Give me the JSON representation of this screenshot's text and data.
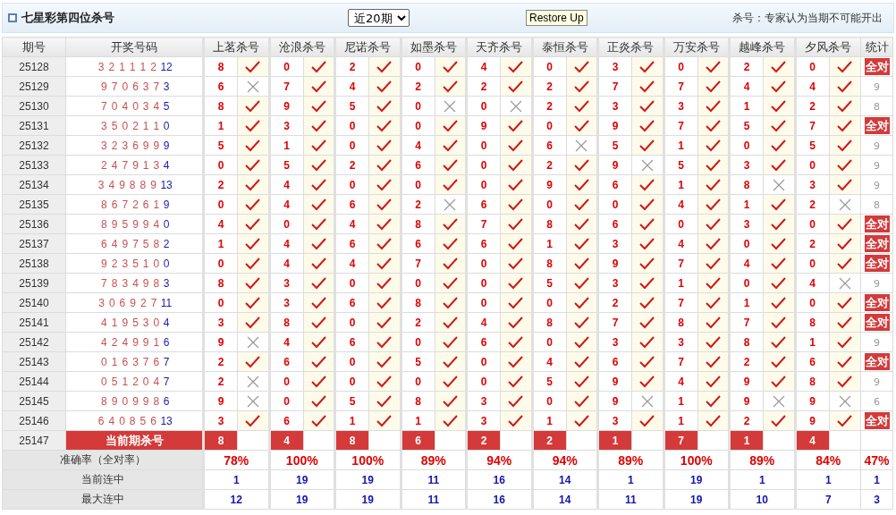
{
  "title": "七星彩第四位杀号",
  "range_select": {
    "value": "近20期"
  },
  "restore_button": "Restore Up",
  "note": "杀号：专家认为当期不可能开出",
  "columns": {
    "period": "期号",
    "draw": "开奖号码",
    "experts": [
      "上茗杀号",
      "沧浪杀号",
      "尼诺杀号",
      "如墨杀号",
      "天齐杀号",
      "泰恒杀号",
      "正炎杀号",
      "万安杀号",
      "越峰杀号",
      "夕风杀号"
    ],
    "stat": "统计"
  },
  "rows": [
    {
      "period": "25128",
      "draw": [
        "3",
        "2",
        "1",
        "1",
        "1",
        "2"
      ],
      "special": "12",
      "kills": [
        {
          "number": "8",
          "hit": true
        },
        {
          "number": "0",
          "hit": true
        },
        {
          "number": "2",
          "hit": true
        },
        {
          "number": "0",
          "hit": true
        },
        {
          "number": "4",
          "hit": true
        },
        {
          "number": "0",
          "hit": true
        },
        {
          "number": "3",
          "hit": true
        },
        {
          "number": "0",
          "hit": true
        },
        {
          "number": "2",
          "hit": true
        },
        {
          "number": "0",
          "hit": true
        }
      ],
      "stat": {
        "kind": "all",
        "text": "全对"
      }
    },
    {
      "period": "25129",
      "draw": [
        "9",
        "7",
        "0",
        "6",
        "3",
        "7"
      ],
      "special": "3",
      "kills": [
        {
          "number": "6",
          "hit": false
        },
        {
          "number": "7",
          "hit": true
        },
        {
          "number": "4",
          "hit": true
        },
        {
          "number": "2",
          "hit": true
        },
        {
          "number": "2",
          "hit": true
        },
        {
          "number": "2",
          "hit": true
        },
        {
          "number": "7",
          "hit": true
        },
        {
          "number": "7",
          "hit": true
        },
        {
          "number": "4",
          "hit": true
        },
        {
          "number": "4",
          "hit": true
        }
      ],
      "stat": {
        "kind": "count",
        "text": "9"
      }
    },
    {
      "period": "25130",
      "draw": [
        "7",
        "0",
        "4",
        "0",
        "3",
        "4"
      ],
      "special": "5",
      "kills": [
        {
          "number": "8",
          "hit": true
        },
        {
          "number": "9",
          "hit": true
        },
        {
          "number": "5",
          "hit": true
        },
        {
          "number": "0",
          "hit": false
        },
        {
          "number": "0",
          "hit": false
        },
        {
          "number": "2",
          "hit": true
        },
        {
          "number": "3",
          "hit": true
        },
        {
          "number": "3",
          "hit": true
        },
        {
          "number": "1",
          "hit": true
        },
        {
          "number": "2",
          "hit": true
        }
      ],
      "stat": {
        "kind": "count",
        "text": "8"
      }
    },
    {
      "period": "25131",
      "draw": [
        "3",
        "5",
        "0",
        "2",
        "1",
        "1"
      ],
      "special": "0",
      "kills": [
        {
          "number": "1",
          "hit": true
        },
        {
          "number": "3",
          "hit": true
        },
        {
          "number": "0",
          "hit": true
        },
        {
          "number": "0",
          "hit": true
        },
        {
          "number": "9",
          "hit": true
        },
        {
          "number": "0",
          "hit": true
        },
        {
          "number": "9",
          "hit": true
        },
        {
          "number": "7",
          "hit": true
        },
        {
          "number": "5",
          "hit": true
        },
        {
          "number": "7",
          "hit": true
        }
      ],
      "stat": {
        "kind": "all",
        "text": "全对"
      }
    },
    {
      "period": "25132",
      "draw": [
        "3",
        "2",
        "3",
        "6",
        "9",
        "9"
      ],
      "special": "9",
      "kills": [
        {
          "number": "5",
          "hit": true
        },
        {
          "number": "1",
          "hit": true
        },
        {
          "number": "0",
          "hit": true
        },
        {
          "number": "4",
          "hit": true
        },
        {
          "number": "0",
          "hit": true
        },
        {
          "number": "6",
          "hit": false
        },
        {
          "number": "5",
          "hit": true
        },
        {
          "number": "1",
          "hit": true
        },
        {
          "number": "0",
          "hit": true
        },
        {
          "number": "5",
          "hit": true
        }
      ],
      "stat": {
        "kind": "count",
        "text": "9"
      }
    },
    {
      "period": "25133",
      "draw": [
        "2",
        "4",
        "7",
        "9",
        "1",
        "3"
      ],
      "special": "4",
      "kills": [
        {
          "number": "0",
          "hit": true
        },
        {
          "number": "5",
          "hit": true
        },
        {
          "number": "2",
          "hit": true
        },
        {
          "number": "6",
          "hit": true
        },
        {
          "number": "0",
          "hit": true
        },
        {
          "number": "2",
          "hit": true
        },
        {
          "number": "9",
          "hit": false
        },
        {
          "number": "5",
          "hit": true
        },
        {
          "number": "3",
          "hit": true
        },
        {
          "number": "0",
          "hit": true
        }
      ],
      "stat": {
        "kind": "count",
        "text": "9"
      }
    },
    {
      "period": "25134",
      "draw": [
        "3",
        "4",
        "9",
        "8",
        "8",
        "9"
      ],
      "special": "13",
      "kills": [
        {
          "number": "2",
          "hit": true
        },
        {
          "number": "4",
          "hit": true
        },
        {
          "number": "0",
          "hit": true
        },
        {
          "number": "0",
          "hit": true
        },
        {
          "number": "0",
          "hit": true
        },
        {
          "number": "9",
          "hit": true
        },
        {
          "number": "6",
          "hit": true
        },
        {
          "number": "1",
          "hit": true
        },
        {
          "number": "8",
          "hit": false
        },
        {
          "number": "3",
          "hit": true
        }
      ],
      "stat": {
        "kind": "count",
        "text": "9"
      }
    },
    {
      "period": "25135",
      "draw": [
        "8",
        "6",
        "7",
        "2",
        "6",
        "1"
      ],
      "special": "9",
      "kills": [
        {
          "number": "0",
          "hit": true
        },
        {
          "number": "4",
          "hit": true
        },
        {
          "number": "6",
          "hit": true
        },
        {
          "number": "2",
          "hit": false
        },
        {
          "number": "6",
          "hit": true
        },
        {
          "number": "0",
          "hit": true
        },
        {
          "number": "0",
          "hit": true
        },
        {
          "number": "4",
          "hit": true
        },
        {
          "number": "1",
          "hit": true
        },
        {
          "number": "2",
          "hit": false
        }
      ],
      "stat": {
        "kind": "count",
        "text": "8"
      }
    },
    {
      "period": "25136",
      "draw": [
        "8",
        "9",
        "5",
        "9",
        "9",
        "4"
      ],
      "special": "0",
      "kills": [
        {
          "number": "4",
          "hit": true
        },
        {
          "number": "0",
          "hit": true
        },
        {
          "number": "4",
          "hit": true
        },
        {
          "number": "8",
          "hit": true
        },
        {
          "number": "7",
          "hit": true
        },
        {
          "number": "8",
          "hit": true
        },
        {
          "number": "6",
          "hit": true
        },
        {
          "number": "0",
          "hit": true
        },
        {
          "number": "3",
          "hit": true
        },
        {
          "number": "0",
          "hit": true
        }
      ],
      "stat": {
        "kind": "all",
        "text": "全对"
      }
    },
    {
      "period": "25137",
      "draw": [
        "6",
        "4",
        "9",
        "7",
        "5",
        "8"
      ],
      "special": "2",
      "kills": [
        {
          "number": "1",
          "hit": true
        },
        {
          "number": "4",
          "hit": true
        },
        {
          "number": "6",
          "hit": true
        },
        {
          "number": "6",
          "hit": true
        },
        {
          "number": "6",
          "hit": true
        },
        {
          "number": "1",
          "hit": true
        },
        {
          "number": "3",
          "hit": true
        },
        {
          "number": "4",
          "hit": true
        },
        {
          "number": "0",
          "hit": true
        },
        {
          "number": "2",
          "hit": true
        }
      ],
      "stat": {
        "kind": "all",
        "text": "全对"
      }
    },
    {
      "period": "25138",
      "draw": [
        "9",
        "2",
        "3",
        "5",
        "1",
        "0"
      ],
      "special": "0",
      "kills": [
        {
          "number": "0",
          "hit": true
        },
        {
          "number": "4",
          "hit": true
        },
        {
          "number": "4",
          "hit": true
        },
        {
          "number": "7",
          "hit": true
        },
        {
          "number": "0",
          "hit": true
        },
        {
          "number": "8",
          "hit": true
        },
        {
          "number": "9",
          "hit": true
        },
        {
          "number": "7",
          "hit": true
        },
        {
          "number": "4",
          "hit": true
        },
        {
          "number": "0",
          "hit": true
        }
      ],
      "stat": {
        "kind": "all",
        "text": "全对"
      }
    },
    {
      "period": "25139",
      "draw": [
        "7",
        "8",
        "3",
        "4",
        "9",
        "8"
      ],
      "special": "3",
      "kills": [
        {
          "number": "8",
          "hit": true
        },
        {
          "number": "3",
          "hit": true
        },
        {
          "number": "0",
          "hit": true
        },
        {
          "number": "0",
          "hit": true
        },
        {
          "number": "0",
          "hit": true
        },
        {
          "number": "5",
          "hit": true
        },
        {
          "number": "3",
          "hit": true
        },
        {
          "number": "1",
          "hit": true
        },
        {
          "number": "0",
          "hit": true
        },
        {
          "number": "4",
          "hit": false
        }
      ],
      "stat": {
        "kind": "count",
        "text": "9"
      }
    },
    {
      "period": "25140",
      "draw": [
        "3",
        "0",
        "6",
        "9",
        "2",
        "7"
      ],
      "special": "11",
      "kills": [
        {
          "number": "0",
          "hit": true
        },
        {
          "number": "3",
          "hit": true
        },
        {
          "number": "6",
          "hit": true
        },
        {
          "number": "8",
          "hit": true
        },
        {
          "number": "0",
          "hit": true
        },
        {
          "number": "0",
          "hit": true
        },
        {
          "number": "2",
          "hit": true
        },
        {
          "number": "7",
          "hit": true
        },
        {
          "number": "1",
          "hit": true
        },
        {
          "number": "0",
          "hit": true
        }
      ],
      "stat": {
        "kind": "all",
        "text": "全对"
      }
    },
    {
      "period": "25141",
      "draw": [
        "4",
        "1",
        "9",
        "5",
        "3",
        "0"
      ],
      "special": "4",
      "kills": [
        {
          "number": "3",
          "hit": true
        },
        {
          "number": "8",
          "hit": true
        },
        {
          "number": "0",
          "hit": true
        },
        {
          "number": "2",
          "hit": true
        },
        {
          "number": "4",
          "hit": true
        },
        {
          "number": "8",
          "hit": true
        },
        {
          "number": "7",
          "hit": true
        },
        {
          "number": "8",
          "hit": true
        },
        {
          "number": "7",
          "hit": true
        },
        {
          "number": "8",
          "hit": true
        }
      ],
      "stat": {
        "kind": "all",
        "text": "全对"
      }
    },
    {
      "period": "25142",
      "draw": [
        "4",
        "2",
        "4",
        "9",
        "9",
        "1"
      ],
      "special": "6",
      "kills": [
        {
          "number": "9",
          "hit": false
        },
        {
          "number": "4",
          "hit": true
        },
        {
          "number": "6",
          "hit": true
        },
        {
          "number": "0",
          "hit": true
        },
        {
          "number": "6",
          "hit": true
        },
        {
          "number": "0",
          "hit": true
        },
        {
          "number": "3",
          "hit": true
        },
        {
          "number": "3",
          "hit": true
        },
        {
          "number": "8",
          "hit": true
        },
        {
          "number": "1",
          "hit": true
        }
      ],
      "stat": {
        "kind": "count",
        "text": "9"
      }
    },
    {
      "period": "25143",
      "draw": [
        "0",
        "1",
        "6",
        "3",
        "7",
        "6"
      ],
      "special": "7",
      "kills": [
        {
          "number": "2",
          "hit": true
        },
        {
          "number": "6",
          "hit": true
        },
        {
          "number": "0",
          "hit": true
        },
        {
          "number": "5",
          "hit": true
        },
        {
          "number": "0",
          "hit": true
        },
        {
          "number": "4",
          "hit": true
        },
        {
          "number": "6",
          "hit": true
        },
        {
          "number": "7",
          "hit": true
        },
        {
          "number": "2",
          "hit": true
        },
        {
          "number": "6",
          "hit": true
        }
      ],
      "stat": {
        "kind": "all",
        "text": "全对"
      }
    },
    {
      "period": "25144",
      "draw": [
        "0",
        "5",
        "1",
        "2",
        "0",
        "4"
      ],
      "special": "7",
      "kills": [
        {
          "number": "2",
          "hit": false
        },
        {
          "number": "0",
          "hit": true
        },
        {
          "number": "0",
          "hit": true
        },
        {
          "number": "0",
          "hit": true
        },
        {
          "number": "0",
          "hit": true
        },
        {
          "number": "5",
          "hit": true
        },
        {
          "number": "9",
          "hit": true
        },
        {
          "number": "4",
          "hit": true
        },
        {
          "number": "9",
          "hit": true
        },
        {
          "number": "8",
          "hit": true
        }
      ],
      "stat": {
        "kind": "count",
        "text": "9"
      }
    },
    {
      "period": "25145",
      "draw": [
        "8",
        "9",
        "0",
        "9",
        "9",
        "8"
      ],
      "special": "6",
      "kills": [
        {
          "number": "9",
          "hit": false
        },
        {
          "number": "0",
          "hit": true
        },
        {
          "number": "5",
          "hit": true
        },
        {
          "number": "8",
          "hit": true
        },
        {
          "number": "3",
          "hit": true
        },
        {
          "number": "0",
          "hit": true
        },
        {
          "number": "9",
          "hit": false
        },
        {
          "number": "1",
          "hit": true
        },
        {
          "number": "9",
          "hit": false
        },
        {
          "number": "9",
          "hit": false
        }
      ],
      "stat": {
        "kind": "count",
        "text": "6"
      }
    },
    {
      "period": "25146",
      "draw": [
        "6",
        "4",
        "0",
        "8",
        "5",
        "6"
      ],
      "special": "13",
      "kills": [
        {
          "number": "3",
          "hit": true
        },
        {
          "number": "6",
          "hit": true
        },
        {
          "number": "1",
          "hit": true
        },
        {
          "number": "1",
          "hit": true
        },
        {
          "number": "3",
          "hit": true
        },
        {
          "number": "1",
          "hit": true
        },
        {
          "number": "3",
          "hit": true
        },
        {
          "number": "1",
          "hit": true
        },
        {
          "number": "2",
          "hit": true
        },
        {
          "number": "9",
          "hit": true
        }
      ],
      "stat": {
        "kind": "all",
        "text": "全对"
      }
    }
  ],
  "current": {
    "period": "25147",
    "label": "当前期杀号",
    "kills": [
      "8",
      "4",
      "8",
      "6",
      "2",
      "2",
      "1",
      "7",
      "1",
      "4"
    ]
  },
  "summary": [
    {
      "kind": "rate",
      "label": "准确率（全对率）",
      "values": [
        "78%",
        "100%",
        "100%",
        "89%",
        "94%",
        "94%",
        "89%",
        "100%",
        "89%",
        "84%"
      ],
      "stat": "47%"
    },
    {
      "kind": "streak",
      "label": "当前连中",
      "values": [
        "1",
        "19",
        "19",
        "11",
        "16",
        "14",
        "1",
        "19",
        "1",
        "1"
      ],
      "stat": "1"
    },
    {
      "kind": "streak",
      "label": "最大连中",
      "values": [
        "12",
        "19",
        "19",
        "11",
        "16",
        "14",
        "11",
        "19",
        "10",
        "7"
      ],
      "stat": "3"
    }
  ]
}
